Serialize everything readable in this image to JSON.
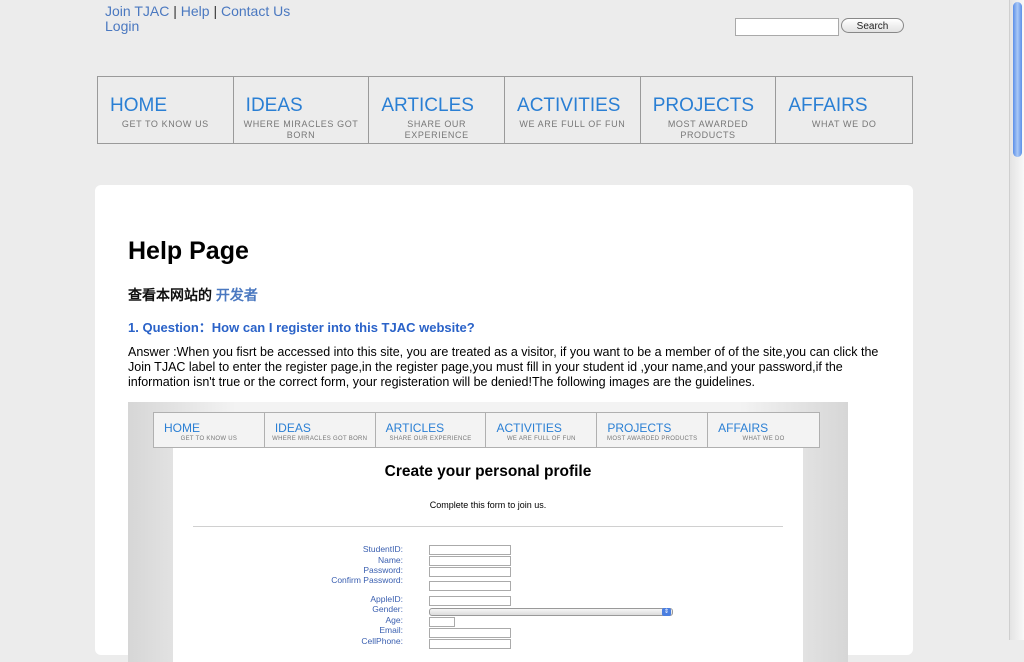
{
  "top_links": {
    "join": "Join TJAC",
    "help": "Help",
    "contact": "Contact Us",
    "login": "Login",
    "separator": "|"
  },
  "search": {
    "button_label": "Search",
    "value": ""
  },
  "nav": [
    {
      "title": "HOME",
      "subtitle": "GET TO KNOW US"
    },
    {
      "title": "IDEAS",
      "subtitle": "WHERE MIRACLES GOT BORN"
    },
    {
      "title": "ARTICLES",
      "subtitle": "SHARE OUR EXPERIENCE"
    },
    {
      "title": "ACTIVITIES",
      "subtitle": "WE ARE FULL OF FUN"
    },
    {
      "title": "PROJECTS",
      "subtitle": "MOST AWARDED PRODUCTS"
    },
    {
      "title": "AFFAIRS",
      "subtitle": "WHAT WE DO"
    }
  ],
  "content": {
    "title": "Help Page",
    "cn_text": "查看本网站的",
    "cn_link": "开发者",
    "question": "1. Question：How can I register into this TJAC website?",
    "answer": "Answer :When you fisrt be accessed into this site, you are treated as a visitor, if you want to be a member of of the site,you can click the Join TJAC label to enter the register page,in the register page,you must fill in your student id ,your name,and your password,if the information isn't true or the correct form, your registeration will be denied!The following images are the guidelines."
  },
  "screenshot": {
    "nav": [
      {
        "title": "HOME",
        "subtitle": "GET TO KNOW US"
      },
      {
        "title": "IDEAS",
        "subtitle": "WHERE MIRACLES GOT BORN"
      },
      {
        "title": "ARTICLES",
        "subtitle": "SHARE OUR EXPERIENCE"
      },
      {
        "title": "ACTIVITIES",
        "subtitle": "WE ARE FULL OF FUN"
      },
      {
        "title": "PROJECTS",
        "subtitle": "MOST AWARDED PRODUCTS"
      },
      {
        "title": "AFFAIRS",
        "subtitle": "WHAT WE DO"
      }
    ],
    "form_title": "Create your personal profile",
    "form_subtitle": "Complete this form to join us.",
    "fields": [
      "StudentID:",
      "Name:",
      "Password:",
      "Confirm Password:",
      "AppleID:",
      "Gender:",
      "Age:",
      "Email:",
      "CellPhone:"
    ]
  }
}
